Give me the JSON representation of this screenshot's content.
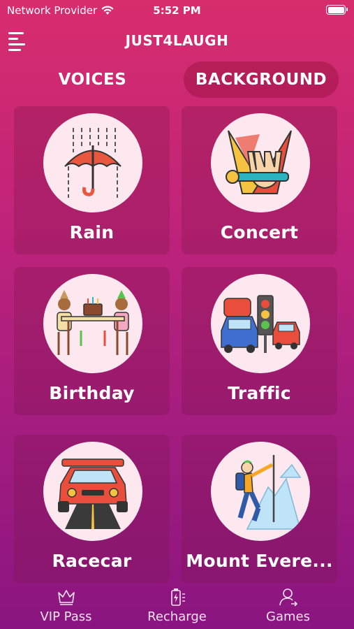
{
  "status_bar": {
    "carrier": "Network Provider",
    "time": "5:52 PM"
  },
  "header": {
    "title": "JUST4LAUGH"
  },
  "tabs": [
    {
      "label": "VOICES",
      "active": false
    },
    {
      "label": "BACKGROUND",
      "active": true
    }
  ],
  "sounds": [
    {
      "label": "Rain",
      "icon": "umbrella-rain-icon"
    },
    {
      "label": "Concert",
      "icon": "concert-microphone-icon"
    },
    {
      "label": "Birthday",
      "icon": "birthday-party-icon"
    },
    {
      "label": "Traffic",
      "icon": "traffic-jam-icon"
    },
    {
      "label": "Racecar",
      "icon": "racecar-icon"
    },
    {
      "label": "Mount Evere...",
      "icon": "mountain-climber-icon"
    }
  ],
  "bottom_nav": [
    {
      "label": "VIP Pass",
      "icon": "crown-icon"
    },
    {
      "label": "Recharge",
      "icon": "battery-charge-icon"
    },
    {
      "label": "Games",
      "icon": "user-switch-icon"
    }
  ],
  "colors": {
    "background_top": "#d72d6c",
    "background_bottom": "#8a1580",
    "circle": "#fce8ee"
  }
}
